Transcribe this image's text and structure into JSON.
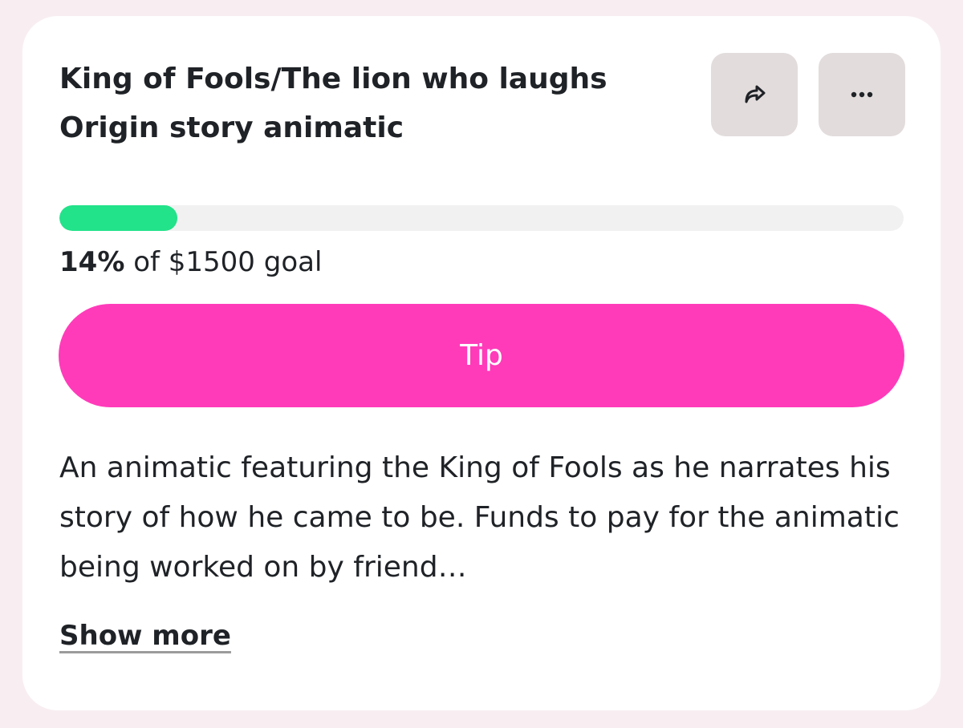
{
  "campaign": {
    "title_line_1": "King of Fools/The lion who laughs",
    "title_line_2": "Origin story animatic",
    "progress": {
      "percent_label": "14%",
      "goal_suffix": " of $1500 goal",
      "fill_percent": 14
    },
    "tip_label": "Tip",
    "description": "An animatic featuring the King of Fools as he narrates his story of how he came to be. Funds to pay for the animatic being worked on by friend…",
    "show_more_label": "Show more",
    "icons": {
      "share": "share-icon",
      "more": "more-icon"
    },
    "colors": {
      "page_background": "#f8eef2",
      "card": "#ffffff",
      "progress_fill": "#22e28a",
      "progress_track": "#f1f1f1",
      "tip_button": "#ff3bba",
      "icon_button": "#e2dcdc",
      "text": "#1f2226"
    }
  }
}
